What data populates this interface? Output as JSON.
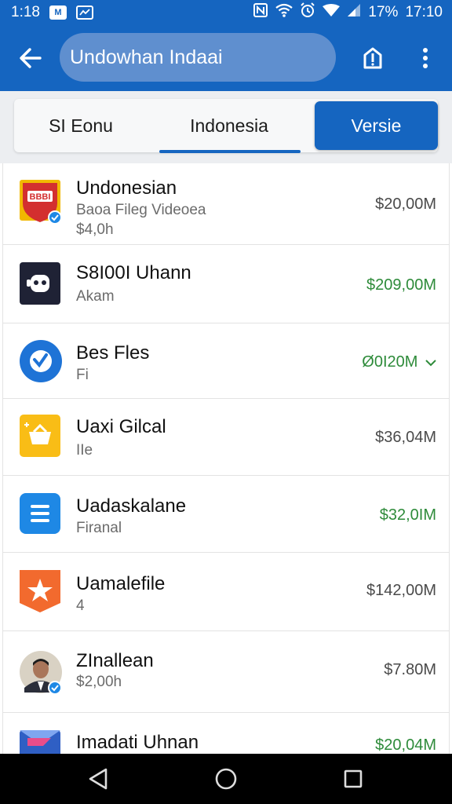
{
  "status_bar": {
    "time": "1:18",
    "icon_m": "M",
    "percent": "17%",
    "right_time": "17:10"
  },
  "app_bar": {
    "search_value": "Undowhan Indaai"
  },
  "tabs": [
    {
      "label": "SI Eonu"
    },
    {
      "label": "Indonesia"
    },
    {
      "label": "Versie"
    }
  ],
  "rows": [
    {
      "title": "Undonesian",
      "subtitle": "Baoa Fileg Videoea",
      "subtitle2": "$4,0h",
      "price": "$20,00M",
      "price_color": "#4a4a4a",
      "icon": "red-shield-icon"
    },
    {
      "title": "S8I00I Uhann",
      "subtitle": "Akam",
      "price": "$209,00M",
      "price_color": "#2e8b3a",
      "icon": "dark-app-icon"
    },
    {
      "title": "Bes Fles",
      "subtitle": "Fi",
      "price": "Ø0I20M",
      "price_color": "#2e8b3a",
      "icon": "blue-circle-check-icon"
    },
    {
      "title": "Uaxi Gilcal",
      "subtitle": "IIe",
      "price": "$36,04M",
      "price_color": "#4a4a4a",
      "icon": "yellow-basket-icon"
    },
    {
      "title": "Uadaskalane",
      "subtitle": "Firanal",
      "price": "$32,0IM",
      "price_color": "#2e8b3a",
      "icon": "blue-menu-icon"
    },
    {
      "title": "Uamalefile",
      "subtitle": "4",
      "price": "$142,00M",
      "price_color": "#4a4a4a",
      "icon": "orange-star-icon"
    },
    {
      "title": "ZInallean",
      "subtitle": "$2,00h",
      "price": "$7.80M",
      "price_color": "#4a4a4a",
      "icon": "person-avatar"
    },
    {
      "title": "Imadati Uhnan",
      "subtitle": "",
      "price": "$20,04M",
      "price_color": "#2e8b3a",
      "icon": "blue-flag-icon"
    }
  ]
}
